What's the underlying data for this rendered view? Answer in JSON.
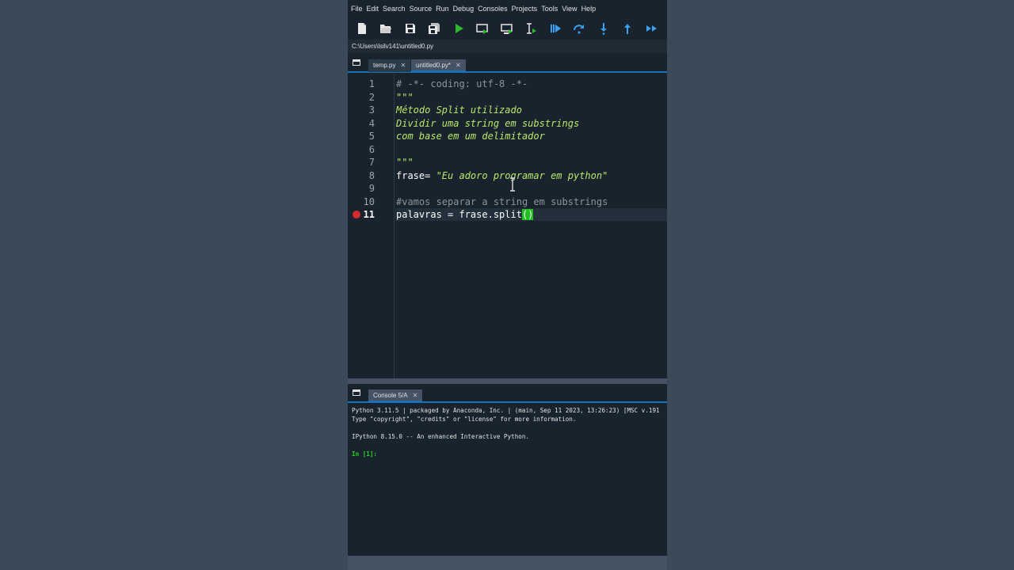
{
  "menu": [
    "File",
    "Edit",
    "Search",
    "Source",
    "Run",
    "Debug",
    "Consoles",
    "Projects",
    "Tools",
    "View",
    "Help"
  ],
  "toolbar": {
    "icons": [
      "new-file-icon",
      "open-folder-icon",
      "save-icon",
      "save-all-icon",
      "run-icon",
      "run-cell-icon",
      "run-cell-advance-icon",
      "run-selection-icon",
      "debug-icon",
      "step-over-icon",
      "step-into-icon",
      "step-return-icon",
      "continue-icon"
    ]
  },
  "path": "C:\\Users\\lsilv141\\untitled0.py",
  "editor": {
    "tabs": [
      {
        "label": "temp.py",
        "active": false
      },
      {
        "label": "untitled0.py*",
        "active": true
      }
    ],
    "current_line": 11,
    "breakpoint_line": 11,
    "lines": [
      "# -*- coding: utf-8 -*-",
      "\"\"\"",
      "Método Split utilizado",
      "Dividir uma string em substrings",
      "com base em um delimitador",
      "",
      "\"\"\"",
      "frase= \"Eu adoro programar em python\"",
      "",
      "#vamos separar a string em substrings",
      "palavras = frase.split()"
    ]
  },
  "console": {
    "tab_label": "Console 5/A",
    "lines": [
      "Python 3.11.5 | packaged by Anaconda, Inc. | (main, Sep 11 2023, 13:26:23) [MSC v.191",
      "Type \"copyright\", \"credits\" or \"license\" for more information.",
      "",
      "IPython 8.15.0 -- An enhanced Interactive Python.",
      ""
    ],
    "prompt": "In [1]:"
  },
  "colors": {
    "accent": "#1a72bb",
    "background": "#19232d",
    "docstring": "#b7e86b",
    "breakpoint": "#d82a2a",
    "prompt": "#27d427"
  }
}
